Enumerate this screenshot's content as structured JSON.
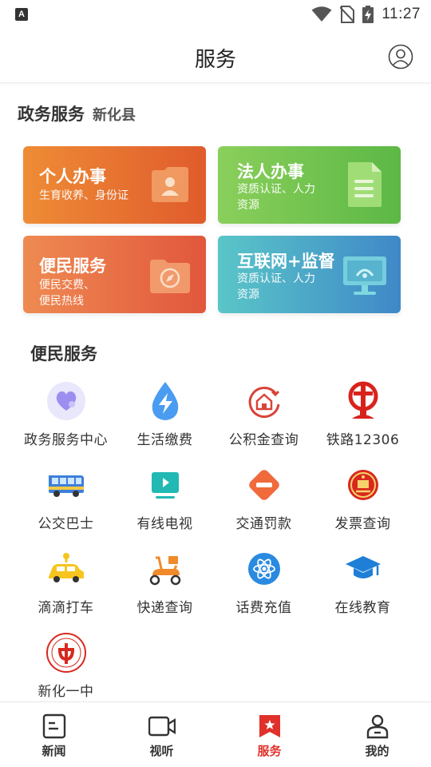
{
  "status_bar": {
    "app_icon_letter": "A",
    "time": "11:27"
  },
  "header": {
    "title": "服务"
  },
  "gov_section": {
    "title": "政务服务",
    "region": "新化县"
  },
  "cards": {
    "personal": {
      "title": "个人办事",
      "subtitle_line1": "生育收养、身份证",
      "subtitle_line2": ""
    },
    "legal": {
      "title": "法人办事",
      "subtitle_line1": "资质认证、人力",
      "subtitle_line2": "资源"
    },
    "civil": {
      "title": "便民服务",
      "subtitle_line1": "便民交费、",
      "subtitle_line2": "便民热线"
    },
    "internet": {
      "title": "互联网+监督",
      "subtitle_line1": "资质认证、人力",
      "subtitle_line2": "资源"
    }
  },
  "convenience": {
    "title": "便民服务",
    "items": [
      {
        "label": "政务服务中心",
        "icon": "heart-icon"
      },
      {
        "label": "生活缴费",
        "icon": "drop-bolt-icon"
      },
      {
        "label": "公积金查询",
        "icon": "house-fund-icon"
      },
      {
        "label": "铁路12306",
        "icon": "railway-icon"
      },
      {
        "label": "公交巴士",
        "icon": "bus-icon"
      },
      {
        "label": "有线电视",
        "icon": "tv-icon"
      },
      {
        "label": "交通罚款",
        "icon": "no-entry-icon"
      },
      {
        "label": "发票查询",
        "icon": "emblem-icon"
      },
      {
        "label": "滴滴打车",
        "icon": "taxi-icon"
      },
      {
        "label": "快递查询",
        "icon": "scooter-icon"
      },
      {
        "label": "话费充值",
        "icon": "atom-icon"
      },
      {
        "label": "在线教育",
        "icon": "graduation-cap-icon"
      },
      {
        "label": "新化一中",
        "icon": "school-seal-icon"
      }
    ]
  },
  "bottom_nav": {
    "items": [
      {
        "label": "新闻",
        "icon": "news-icon"
      },
      {
        "label": "视听",
        "icon": "video-icon"
      },
      {
        "label": "服务",
        "icon": "service-bookmark-icon"
      },
      {
        "label": "我的",
        "icon": "person-icon"
      }
    ],
    "active_index": 2
  },
  "colors": {
    "accent_red": "#e0312a",
    "card_orange": "#e05b2c",
    "card_green": "#5cb845",
    "card_red_orange": "#e1573c",
    "card_teal_blue": "#3f88c8"
  }
}
